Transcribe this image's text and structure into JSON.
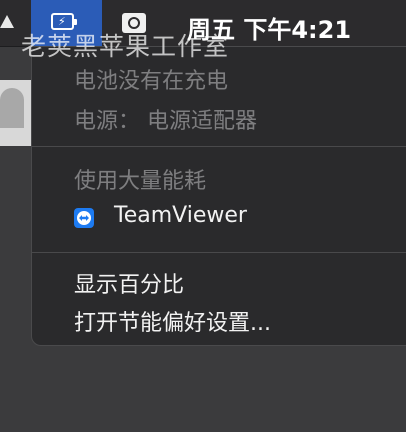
{
  "menubar": {
    "clock": "周五 下午4:21",
    "watermark": "老荚黑苹果工作室"
  },
  "battery_menu": {
    "status": "电池没有在充电",
    "power_source": "电源： 电源适配器",
    "energy_heading": "使用大量能耗",
    "apps": [
      {
        "label": "TeamViewer",
        "icon": "teamviewer-icon"
      }
    ],
    "show_percentage": "显示百分比",
    "open_energy_prefs": "打开节能偏好设置..."
  },
  "colors": {
    "highlight": "#2b5cb7",
    "menu_bg": "#2a2a2c",
    "disabled_text": "#7e7e80",
    "enabled_text": "#f2f2f2"
  }
}
